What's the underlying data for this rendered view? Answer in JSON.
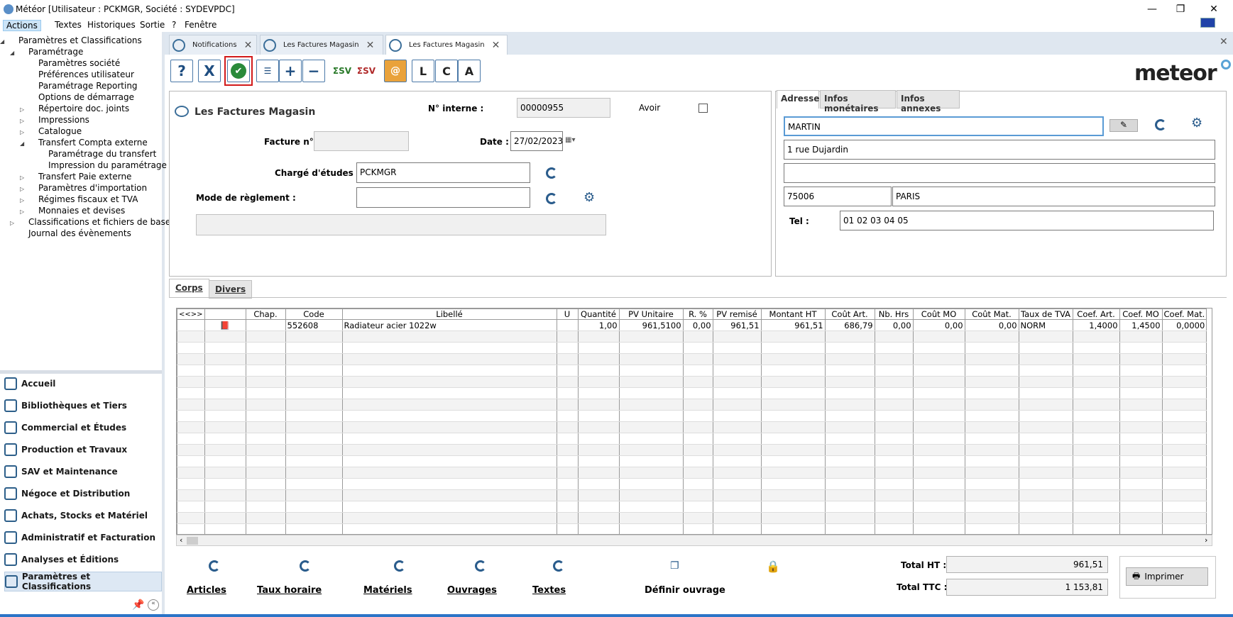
{
  "window": {
    "title": "Météor [Utilisateur : PCKMGR, Société : SYDEVPDC]",
    "minimize": "—",
    "maximize": "❐",
    "close": "✕"
  },
  "menu": [
    "Actions",
    "Textes",
    "Historiques",
    "Sortie",
    "?",
    "Fenêtre"
  ],
  "tree": [
    {
      "label": "Paramètres et Classifications",
      "arrow": "◢"
    },
    {
      "label": "Paramétrage",
      "arrow": "◢"
    },
    {
      "label": "Paramètres société",
      "arrow": ""
    },
    {
      "label": "Préférences utilisateur",
      "arrow": ""
    },
    {
      "label": "Paramétrage Reporting",
      "arrow": ""
    },
    {
      "label": "Options de démarrage",
      "arrow": ""
    },
    {
      "label": "Répertoire doc. joints",
      "arrow": "▷"
    },
    {
      "label": "Impressions",
      "arrow": "▷"
    },
    {
      "label": "Catalogue",
      "arrow": "▷"
    },
    {
      "label": "Transfert Compta externe",
      "arrow": "◢"
    },
    {
      "label": "Paramétrage du transfert",
      "arrow": ""
    },
    {
      "label": "Impression du paramétrage",
      "arrow": ""
    },
    {
      "label": "Transfert Paie externe",
      "arrow": "▷"
    },
    {
      "label": "Paramètres d'importation",
      "arrow": "▷"
    },
    {
      "label": "Régimes fiscaux et TVA",
      "arrow": "▷"
    },
    {
      "label": "Monnaies et devises",
      "arrow": "▷"
    },
    {
      "label": "Classifications et fichiers de base",
      "arrow": "▷"
    },
    {
      "label": "Journal des évènements",
      "arrow": ""
    }
  ],
  "nav": [
    "Accueil",
    "Bibliothèques et Tiers",
    "Commercial et Études",
    "Production et Travaux",
    "SAV et Maintenance",
    "Négoce et Distribution",
    "Achats, Stocks et Matériel",
    "Administratif et Facturation",
    "Analyses et Éditions",
    "Paramètres et Classifications"
  ],
  "tabs": [
    "Notifications",
    "Les Factures Magasin",
    "Les Factures Magasin"
  ],
  "toolbar": {
    "help": "?",
    "cancel": "X",
    "validate": "✔",
    "plus": "+",
    "minus": "−",
    "sv": "ΣSV",
    "letters": [
      "L",
      "C",
      "A"
    ]
  },
  "logo": "meteor",
  "form": {
    "title": "Les Factures Magasin",
    "num_interne_label": "N° interne :",
    "num_interne": "00000955",
    "avoir_label": "Avoir",
    "facture_label": "Facture n°",
    "facture": "",
    "date_label": "Date :",
    "date": "27/02/2023",
    "charge_label": "Chargé d'études :",
    "charge": "PCKMGR",
    "mode_label": "Mode de règlement :",
    "mode": ""
  },
  "addr": {
    "tabs": [
      "Adresse",
      "Infos monétaires",
      "Infos annexes"
    ],
    "name": "MARTIN",
    "line1": "1 rue Dujardin",
    "line2": "",
    "cp": "75006",
    "ville": "PARIS",
    "tel_label": "Tel :",
    "tel": "01 02 03 04 05"
  },
  "body_tabs": [
    "Corps",
    "Divers"
  ],
  "grid": {
    "nav": "<<>>",
    "headers": [
      "Chap.",
      "Code",
      "Libellé",
      "U",
      "Quantité",
      "PV Unitaire",
      "R. %",
      "PV remisé",
      "Montant HT",
      "Coût Art.",
      "Nb. Hrs",
      "Coût MO",
      "Coût Mat.",
      "Taux de TVA",
      "Coef. Art.",
      "Coef. MO",
      "Coef. Mat."
    ],
    "row": [
      "",
      "552608",
      "Radiateur acier 1022w",
      "",
      "1,00",
      "961,5100",
      "0,00",
      "961,51",
      "961,51",
      "686,79",
      "0,00",
      "0,00",
      "0,00",
      "NORM",
      "1,4000",
      "1,4500",
      "0,0000"
    ]
  },
  "actions": [
    "Articles",
    "Taux horaire",
    "Matériels",
    "Ouvrages",
    "Textes",
    "Définir ouvrage"
  ],
  "totals": {
    "ht_label": "Total HT :",
    "ht": "961,51",
    "ttc_label": "Total TTC :",
    "ttc": "1 153,81",
    "print": "Imprimer"
  },
  "colors": {
    "accent": "#2a5c8c",
    "selection_red": "#d21a1a",
    "statusbar": "#2b74c7"
  }
}
